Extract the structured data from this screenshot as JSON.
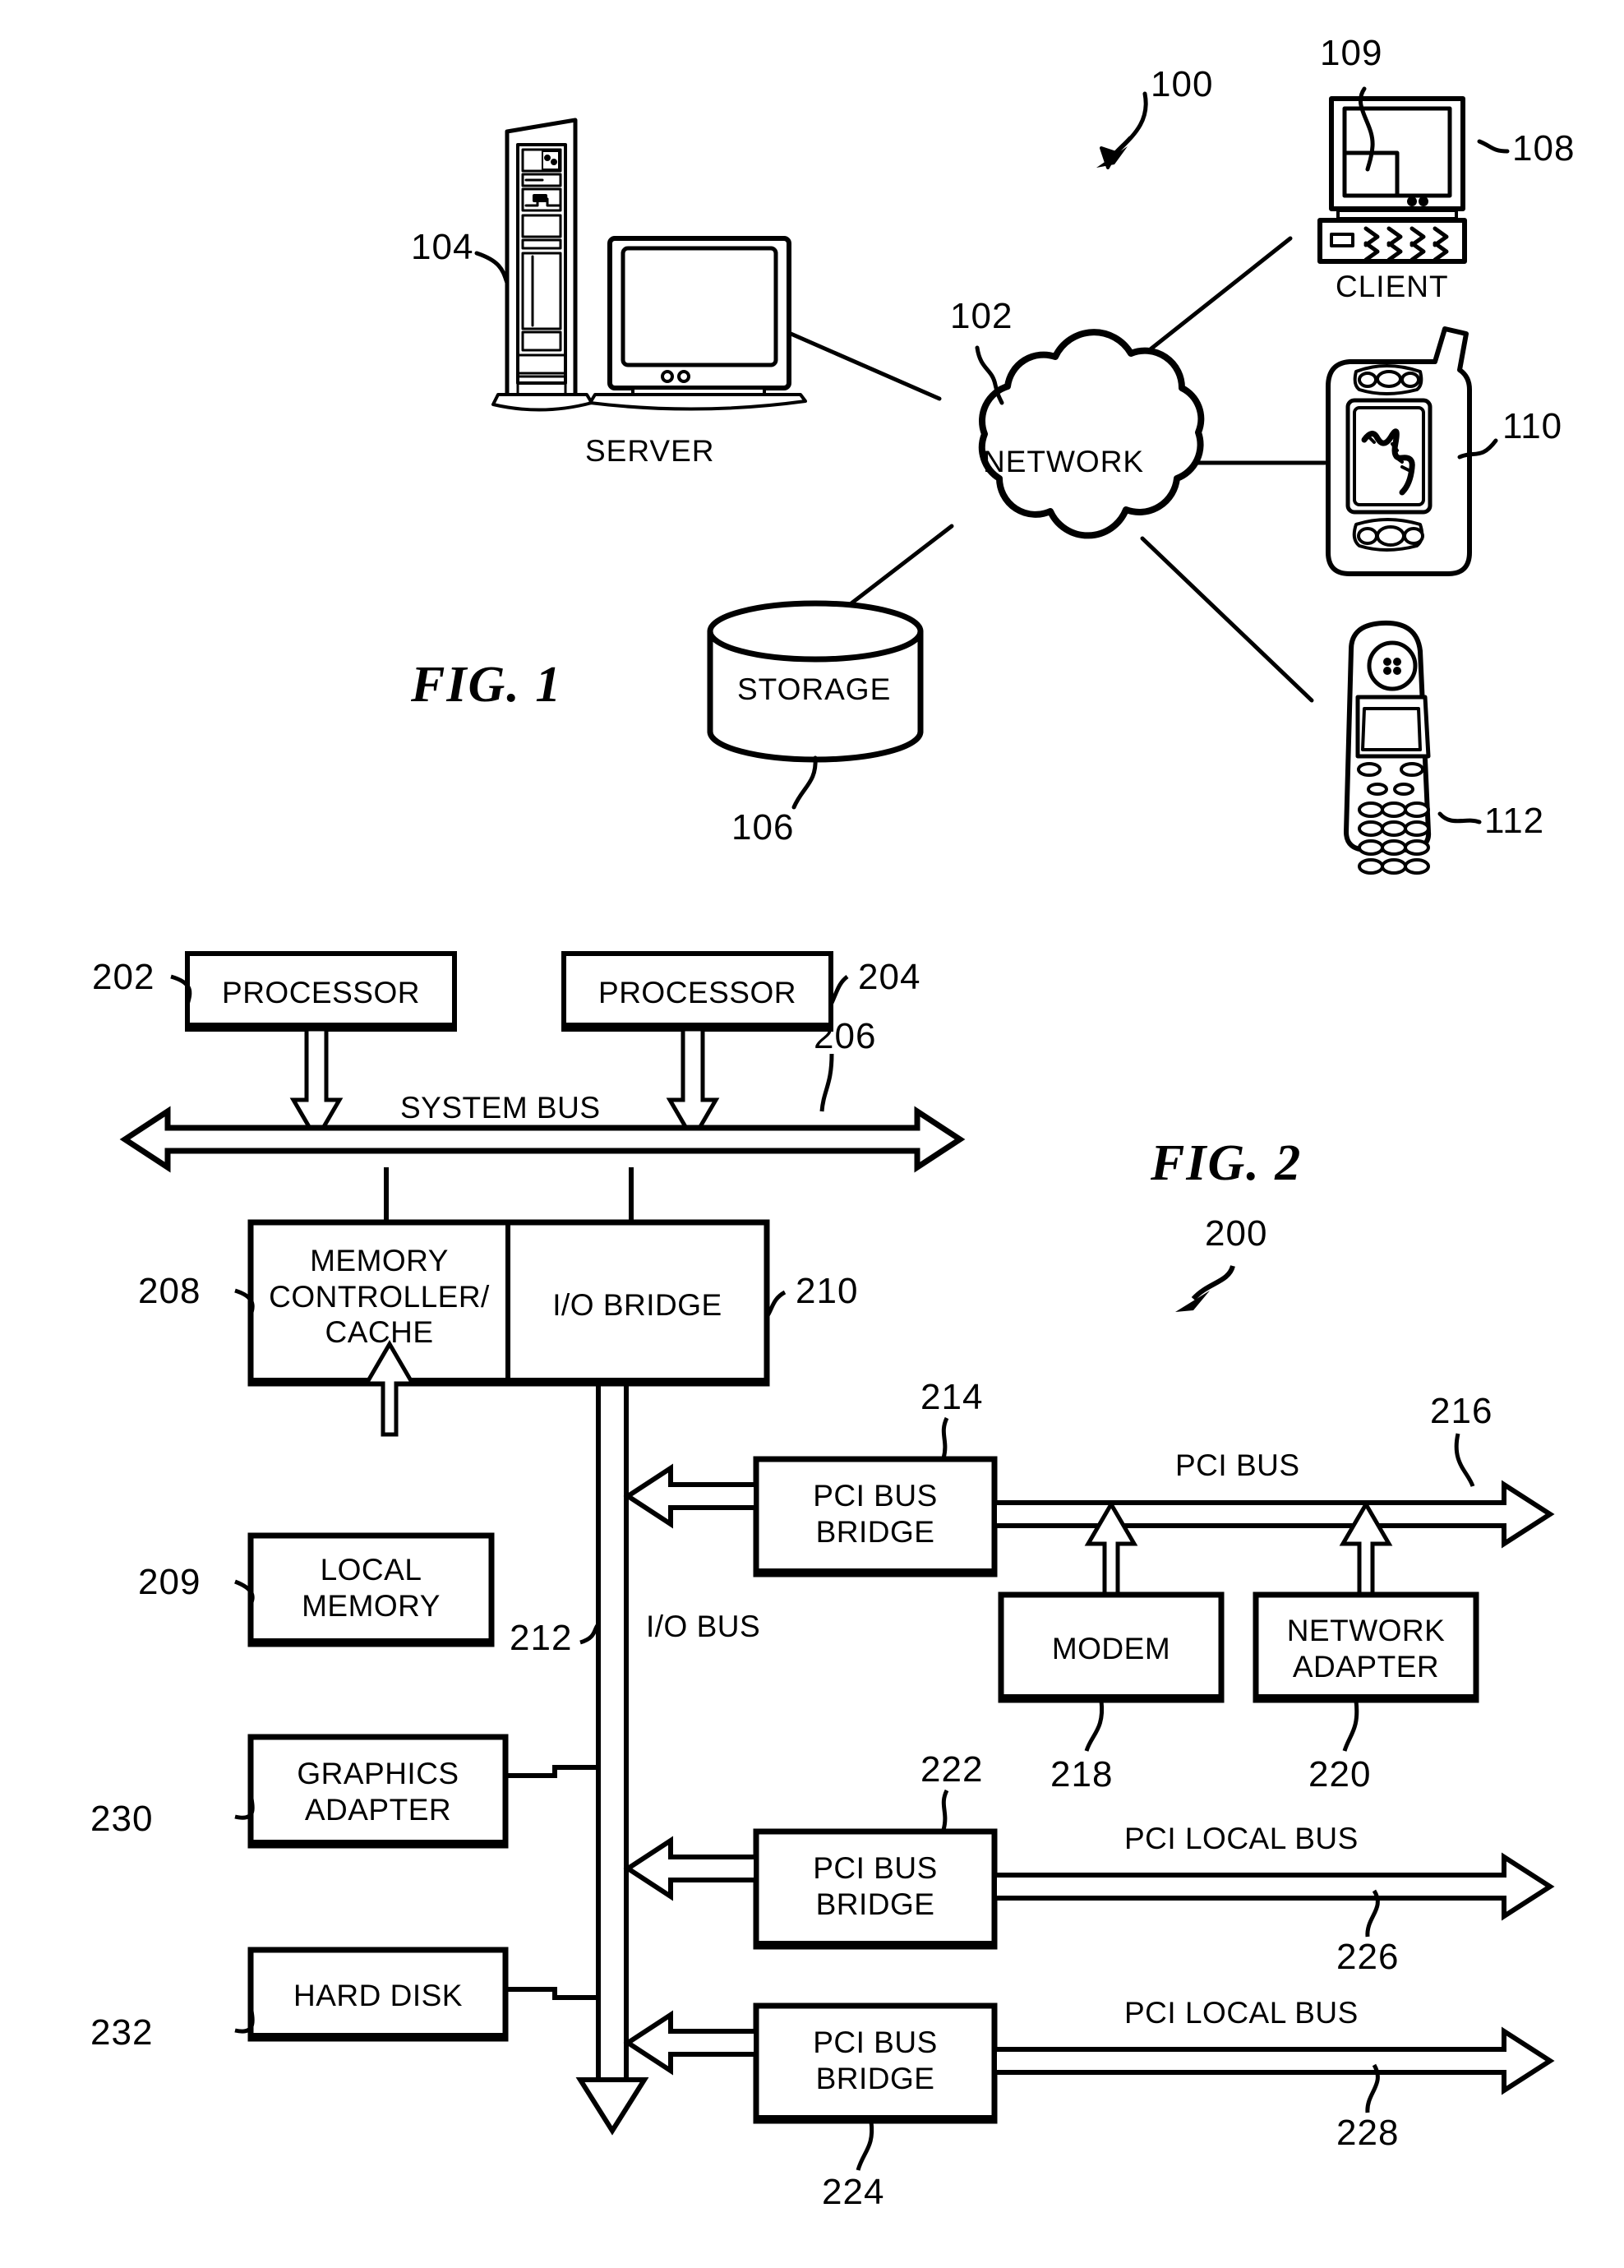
{
  "figures": [
    {
      "id": "fig1",
      "caption": "FIG. 1",
      "system_ref": "100",
      "nodes": {
        "server": {
          "label": "SERVER",
          "ref": "104"
        },
        "network": {
          "label": "NETWORK",
          "ref": "102"
        },
        "storage": {
          "label": "STORAGE",
          "ref": "106"
        },
        "client": {
          "label": "CLIENT",
          "ref_device": "108",
          "ref_screen": "109"
        },
        "pda": {
          "label": "",
          "ref": "110"
        },
        "cellphone": {
          "label": "",
          "ref": "112"
        }
      }
    },
    {
      "id": "fig2",
      "caption": "FIG. 2",
      "system_ref": "200",
      "blocks": {
        "processor_left": {
          "label": "PROCESSOR",
          "ref": "202"
        },
        "processor_right": {
          "label": "PROCESSOR",
          "ref": "204"
        },
        "memory_controller": {
          "label": "MEMORY\nCONTROLLER/\nCACHE",
          "ref": "208"
        },
        "io_bridge": {
          "label": "I/O BRIDGE",
          "ref": "210"
        },
        "local_memory": {
          "label": "LOCAL\nMEMORY",
          "ref": "209"
        },
        "pci_bus_bridge_1": {
          "label": "PCI BUS\nBRIDGE",
          "ref": "214"
        },
        "pci_bus_bridge_2": {
          "label": "PCI BUS\nBRIDGE",
          "ref": "222"
        },
        "pci_bus_bridge_3": {
          "label": "PCI BUS\nBRIDGE",
          "ref": "224"
        },
        "modem": {
          "label": "MODEM",
          "ref": "218"
        },
        "network_adapter": {
          "label": "NETWORK\nADAPTER",
          "ref": "220"
        },
        "graphics_adapter": {
          "label": "GRAPHICS\nADAPTER",
          "ref": "230"
        },
        "hard_disk": {
          "label": "HARD DISK",
          "ref": "232"
        }
      },
      "buses": {
        "system_bus": {
          "label": "SYSTEM BUS",
          "ref": "206"
        },
        "io_bus": {
          "label": "I/O\nBUS",
          "ref": "212"
        },
        "pci_bus": {
          "label": "PCI BUS",
          "ref": "216"
        },
        "pci_local_bus_1": {
          "label": "PCI LOCAL BUS",
          "ref": "226"
        },
        "pci_local_bus_2": {
          "label": "PCI LOCAL BUS",
          "ref": "228"
        }
      }
    }
  ],
  "colors": {
    "ink": "#000000",
    "paper": "#ffffff"
  }
}
